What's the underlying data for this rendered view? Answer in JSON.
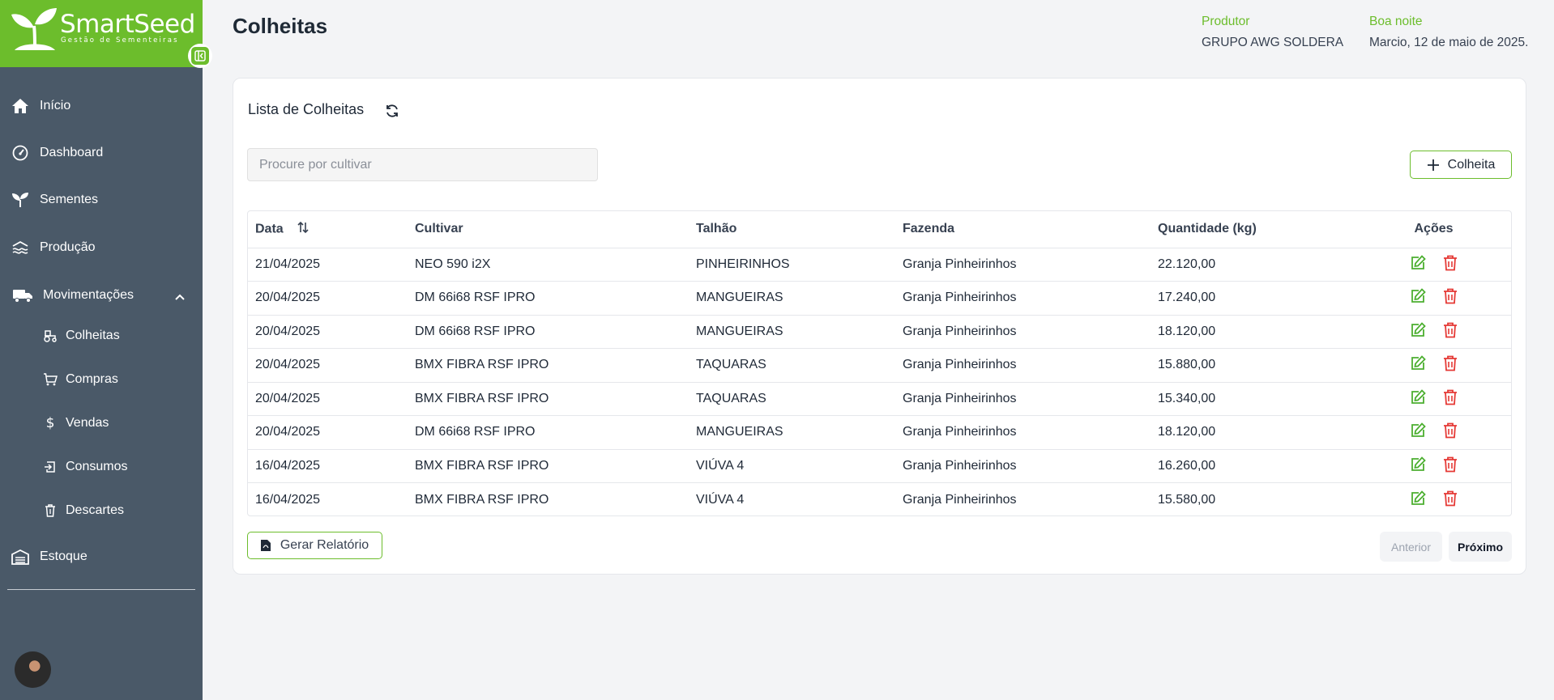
{
  "brand": {
    "name": "SmartSeed",
    "tagline": "Gestão de Sementeiras",
    "accent": "#6cbd2c",
    "sidebar_bg": "#4a5968"
  },
  "sidebar": {
    "items": [
      {
        "label": "Início",
        "icon": "home-icon"
      },
      {
        "label": "Dashboard",
        "icon": "gauge-icon"
      },
      {
        "label": "Sementes",
        "icon": "seedling-icon"
      },
      {
        "label": "Produção",
        "icon": "production-icon"
      },
      {
        "label": "Movimentações",
        "icon": "truck-icon",
        "expanded": true
      },
      {
        "label": "Estoque",
        "icon": "warehouse-icon"
      }
    ],
    "sub_items": [
      {
        "label": "Colheitas",
        "icon": "tractor-icon"
      },
      {
        "label": "Compras",
        "icon": "cart-icon"
      },
      {
        "label": "Vendas",
        "icon": "dollar-icon"
      },
      {
        "label": "Consumos",
        "icon": "consume-icon"
      },
      {
        "label": "Descartes",
        "icon": "trash-icon"
      }
    ]
  },
  "header": {
    "title": "Colheitas",
    "producer_label": "Produtor",
    "producer_value": "GRUPO AWG SOLDERA",
    "greeting_label": "Boa noite",
    "greeting_value": "Marcio, 12 de maio de 2025."
  },
  "card": {
    "title": "Lista de Colheitas",
    "search_placeholder": "Procure por cultivar",
    "add_label": "Colheita",
    "report_label": "Gerar Relatório",
    "prev_label": "Anterior",
    "next_label": "Próximo"
  },
  "table": {
    "headers": [
      "Data",
      "Cultivar",
      "Talhão",
      "Fazenda",
      "Quantidade (kg)",
      "Ações"
    ],
    "rows": [
      [
        "21/04/2025",
        "NEO 590 i2X",
        "PINHEIRINHOS",
        "Granja Pinheirinhos",
        "22.120,00"
      ],
      [
        "20/04/2025",
        "DM 66i68 RSF IPRO",
        "MANGUEIRAS",
        "Granja Pinheirinhos",
        "17.240,00"
      ],
      [
        "20/04/2025",
        "DM 66i68 RSF IPRO",
        "MANGUEIRAS",
        "Granja Pinheirinhos",
        "18.120,00"
      ],
      [
        "20/04/2025",
        "BMX FIBRA RSF IPRO",
        "TAQUARAS",
        "Granja Pinheirinhos",
        "15.880,00"
      ],
      [
        "20/04/2025",
        "BMX FIBRA RSF IPRO",
        "TAQUARAS",
        "Granja Pinheirinhos",
        "15.340,00"
      ],
      [
        "20/04/2025",
        "DM 66i68 RSF IPRO",
        "MANGUEIRAS",
        "Granja Pinheirinhos",
        "18.120,00"
      ],
      [
        "16/04/2025",
        "BMX FIBRA RSF IPRO",
        "VIÚVA 4",
        "Granja Pinheirinhos",
        "16.260,00"
      ],
      [
        "16/04/2025",
        "BMX FIBRA RSF IPRO",
        "VIÚVA 4",
        "Granja Pinheirinhos",
        "15.580,00"
      ]
    ]
  }
}
